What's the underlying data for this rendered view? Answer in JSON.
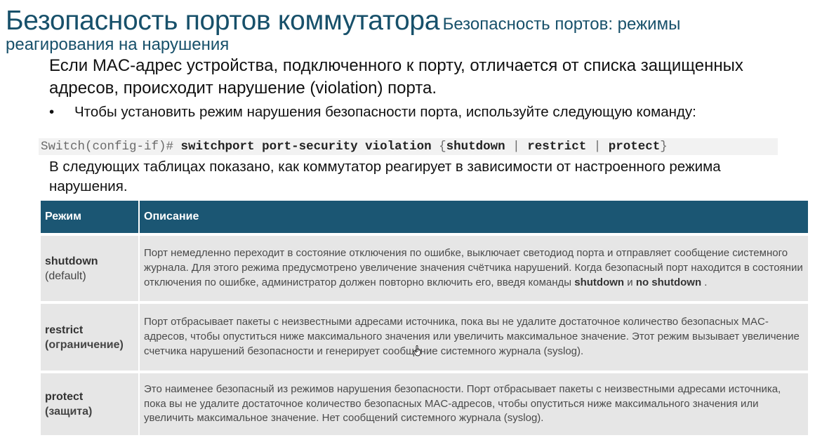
{
  "title": {
    "main": "Безопасность портов коммутатора",
    "sub_part1": "Безопасность портов: режимы",
    "sub_part2": "реагирования на нарушения"
  },
  "intro": "Если MAC-адрес устройства, подключенного к порту, отличается от списка защищенных адресов, происходит нарушение (violation) порта.",
  "bullet": {
    "marker": "•",
    "text": "Чтобы установить режим нарушения безопасности порта, используйте следующую команду:"
  },
  "command": {
    "prompt": "Switch(config-if)#",
    "keyword": "switchport port-security violation",
    "brace_open": "{",
    "opt1": "shutdown",
    "sep": "|",
    "opt2": "restrict",
    "opt3": "protect",
    "brace_close": "}"
  },
  "tables_intro": "В следующих таблицах показано, как коммутатор реагирует в зависимости от настроенного режима нарушения.",
  "table": {
    "headers": [
      "Режим",
      "Описание"
    ],
    "rows": [
      {
        "mode": "shutdown",
        "mode_sub": "(default)",
        "desc_pre": "Порт немедленно переходит в состояние отключения по ошибке, выключает светодиод порта и отправляет сообщение системного журнала. Для этого режима предусмотрено увеличение значения счётчика нарушений. Когда безопасный порт находится в состоянии отключения по ошибке, администратор должен повторно включить его, введя команды ",
        "desc_cmd1": "shutdown",
        "desc_and": " и ",
        "desc_cmd2": "no shutdown",
        "desc_post": " ."
      },
      {
        "mode": "restrict",
        "mode_sub": "(ограничение)",
        "desc": "Порт отбрасывает пакеты с неизвестными адресами источника, пока вы не удалите достаточное количество безопасных MAC-адресов, чтобы опуститься ниже максимального значения или увеличить максимальное значение. Этот режим вызывает увеличение счетчика нарушений безопасности и генерирует сообщение системного журнала (syslog)."
      },
      {
        "mode": "protect",
        "mode_sub": "(защита)",
        "desc": "Это наименее безопасный из режимов нарушения безопасности. Порт отбрасывает пакеты с неизвестными адресами источника, пока вы не удалите достаточное количество безопасных MAC-адресов, чтобы опуститься ниже максимального значения или увеличить максимальное значение. Нет сообщений системного журнала (syslog)."
      }
    ]
  },
  "colors": {
    "title": "#17506a",
    "table_header_bg": "#1b5673",
    "table_cell_bg": "#e6e6e6",
    "command_bg": "#f2f2f2"
  },
  "icons": {
    "cursor": "hand-pointer-icon"
  }
}
